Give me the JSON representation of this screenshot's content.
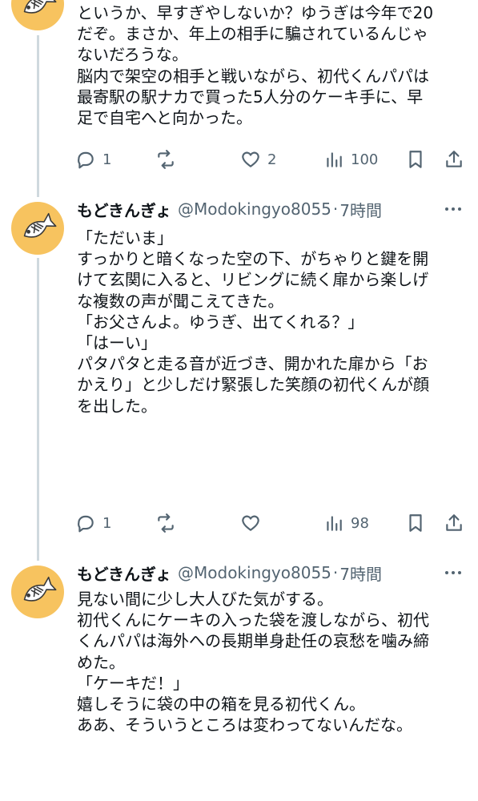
{
  "tweets": [
    {
      "lines": [
        "というか、早すぎやしないか？ゆうぎは今年で20",
        "だぞ。まさか、年上の相手に騙されているんじゃ",
        "ないだろうな。",
        "脳内で架空の相手と戦いながら、初代くんパパは",
        "最寄駅の駅ナカで買った5人分のケーキ手に、早",
        "足で自宅へと向かった。"
      ],
      "replies": "1",
      "retweets": "",
      "likes": "2",
      "views": "100"
    },
    {
      "name": "もどきんぎょ",
      "handle": "@Modokingyo8055",
      "dot": "·",
      "time": "7時間",
      "lines": [
        "「ただいま」",
        "",
        "すっかりと暗くなった空の下、がちゃりと鍵を開",
        "けて玄関に入ると、リビングに続く扉から楽しげ",
        "な複数の声が聞こえてきた。",
        "",
        "「お父さんよ。ゆうぎ、出てくれる？」",
        "「はーい」",
        "",
        "パタパタと走る音が近づき、開かれた扉から「お",
        "かえり」と少しだけ緊張した笑顔の初代くんが顔",
        "を出した。"
      ],
      "replies": "1",
      "retweets": "",
      "likes": "",
      "views": "98"
    },
    {
      "name": "もどきんぎょ",
      "handle": "@Modokingyo8055",
      "dot": "·",
      "time": "7時間",
      "lines": [
        "見ない間に少し大人びた気がする。",
        "初代くんにケーキの入った袋を渡しながら、初代",
        "くんパパは海外への長期単身赴任の哀愁を噛み締",
        "めた。",
        "",
        "「ケーキだ！」",
        "",
        "嬉しそうに袋の中の箱を見る初代くん。",
        "ああ、そういうところは変わってないんだな。"
      ]
    }
  ],
  "colors": {
    "text": "#0f1419",
    "secondary": "#536471",
    "avatar_bg": "#f7c35f",
    "thread_line": "#cfd9de"
  },
  "icons": [
    "fish-avatar-icon",
    "more-icon",
    "reply-icon",
    "retweet-icon",
    "like-icon",
    "views-icon",
    "bookmark-icon",
    "share-icon"
  ]
}
